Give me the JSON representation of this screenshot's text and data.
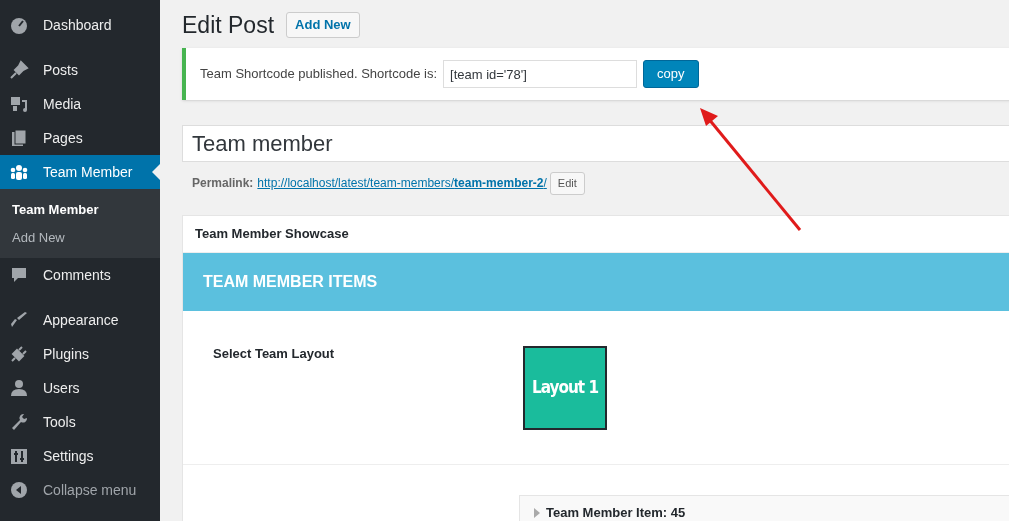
{
  "sidebar": {
    "groups": [
      [
        {
          "label": "Dashboard",
          "selected": false
        }
      ],
      [
        {
          "label": "Posts",
          "selected": false
        },
        {
          "label": "Media",
          "selected": false
        },
        {
          "label": "Pages",
          "selected": false
        },
        {
          "label": "Team Member",
          "selected": true,
          "children": [
            {
              "label": "Team Member",
              "selected": true
            },
            {
              "label": "Add New",
              "selected": false
            }
          ]
        },
        {
          "label": "Comments",
          "selected": false
        }
      ],
      [
        {
          "label": "Appearance",
          "selected": false
        },
        {
          "label": "Plugins",
          "selected": false
        },
        {
          "label": "Users",
          "selected": false
        },
        {
          "label": "Tools",
          "selected": false
        },
        {
          "label": "Settings",
          "selected": false
        }
      ]
    ],
    "collapse": "Collapse menu"
  },
  "page": {
    "title": "Edit Post",
    "add_new": "Add New"
  },
  "notice": {
    "text": "Team Shortcode published. Shortcode is:",
    "shortcode": "[team id='78']",
    "button": "copy"
  },
  "post_title": "Team member",
  "permalink": {
    "label": "Permalink:",
    "url_base": "http://localhost/latest/team-members/",
    "slug": "team-member-2",
    "url_end": "/",
    "button": "Edit"
  },
  "metabox": {
    "title": "Team Member Showcase",
    "band": "TEAM MEMBER ITEMS",
    "layout_label": "Select Team Layout",
    "layout_option": "Layout 1",
    "item": "Team Member Item: 45"
  }
}
